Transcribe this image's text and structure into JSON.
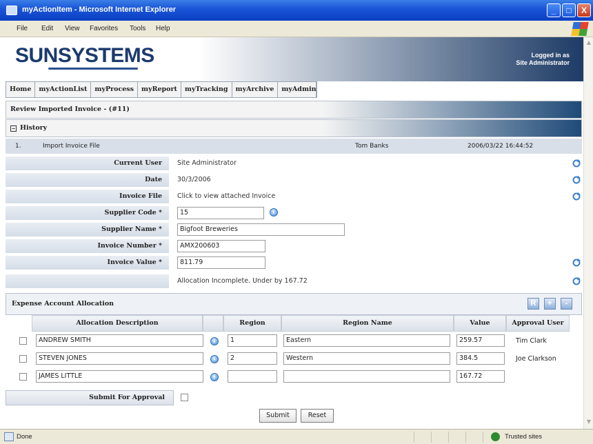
{
  "window": {
    "title": "myActionItem - Microsoft Internet Explorer",
    "min": "_",
    "max": "□",
    "close": "X"
  },
  "menu": [
    "File",
    "Edit",
    "View",
    "Favorites",
    "Tools",
    "Help"
  ],
  "header": {
    "logo": "SUNSYSTEMS",
    "logged_in_line1": "Logged in as",
    "logged_in_line2": "Site Administrator"
  },
  "nav": [
    "Home",
    "myActionList",
    "myProcess",
    "myReport",
    "myTracking",
    "myArchive",
    "myAdmin"
  ],
  "page_title": "Review Imported Invoice - (#11)",
  "history": {
    "label": "History",
    "toggle": "−",
    "row": {
      "num": "1.",
      "action": "Import Invoice File",
      "user": "Tom Banks",
      "timestamp": "2006/03/22 16:44:52"
    }
  },
  "fields": {
    "current_user": {
      "label": "Current User",
      "value": "Site Administrator"
    },
    "date": {
      "label": "Date",
      "value": "30/3/2006"
    },
    "invoice_file": {
      "label": "Invoice File",
      "value": "Click to view attached Invoice"
    },
    "supplier_code": {
      "label": "Supplier Code *",
      "value": "15"
    },
    "supplier_name": {
      "label": "Supplier Name *",
      "value": "Bigfoot Breweries"
    },
    "invoice_number": {
      "label": "Invoice Number *",
      "value": "AMX200603"
    },
    "invoice_value": {
      "label": "Invoice Value *",
      "value": "811.79"
    },
    "allocation_status": "Allocation Incomplete. Under by 167.72"
  },
  "expense": {
    "title": "Expense Account Allocation",
    "buttons": [
      "R",
      "+",
      "-"
    ],
    "columns": [
      "Allocation Description",
      "Region",
      "Region Name",
      "Value",
      "Approval User"
    ],
    "rows": [
      {
        "description": "ANDREW SMITH",
        "region": "1",
        "region_name": "Eastern",
        "value": "259.57",
        "approver": "Tim Clark"
      },
      {
        "description": "STEVEN JONES",
        "region": "2",
        "region_name": "Western",
        "value": "384.5",
        "approver": "Joe Clarkson"
      },
      {
        "description": "JAMES LITTLE",
        "region": "",
        "region_name": "",
        "value": "167.72",
        "approver": ""
      }
    ]
  },
  "submit_for_approval": "Submit For Approval",
  "buttons": {
    "submit": "Submit",
    "reset": "Reset"
  },
  "status": {
    "left": "Done",
    "right": "Trusted sites"
  },
  "colors": {
    "title_blue": "#1b56d8",
    "header_navy": "#1d3b66",
    "label_bg": "#dbe1ea"
  }
}
